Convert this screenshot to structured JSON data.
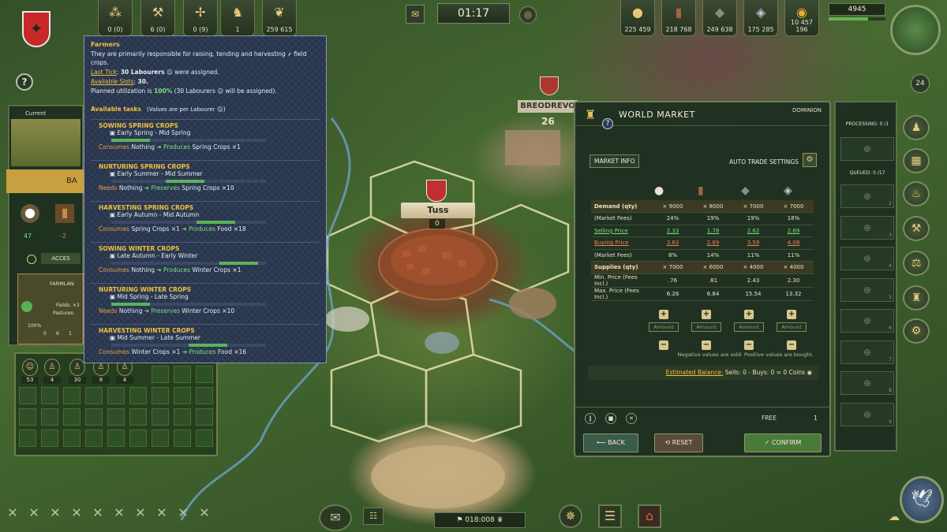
{
  "top_bar": {
    "workers": [
      "0 (0)",
      "6 (0)",
      "0 (9)",
      "1",
      "259 615"
    ],
    "clock": "01:17",
    "resources": [
      "225 459",
      "218 768",
      "249 638",
      "175 285",
      "10 457 196"
    ],
    "gold_value": "4945",
    "notifications": "24"
  },
  "tooltip": {
    "title": "Farmers",
    "desc": "They are primarily responsible for raising, tending and harvesting",
    "desc_tail": "field crops.",
    "last_tick_label": "Last Tick",
    "last_tick_value": "30 Labourers",
    "last_tick_tail": "were assigned.",
    "slots_label": "Available Slots",
    "slots_value": "30.",
    "planned_prefix": "Planned utilization is",
    "planned_value": "100%",
    "planned_tail": "(30 Labourers",
    "planned_tail2": "will be assigned).",
    "available_tasks": "Available tasks",
    "values_note": "(Values are per Labourer",
    "values_note_tail": ")",
    "tasks": [
      {
        "name": "SOWING SPRING CROPS",
        "dates": "Early Spring - Mid Spring",
        "k1": "Consumes",
        "in": "Nothing",
        "k2": "Produces",
        "out": "Spring Crops ×1",
        "progress": 0.25
      },
      {
        "name": "NURTURING SPRING CROPS",
        "dates": "Early Summer - Mid Summer",
        "k1": "Needs",
        "in": "Nothing",
        "k2": "Preserves",
        "out": "Spring Crops ×10",
        "progress": 0.25
      },
      {
        "name": "HARVESTING SPRING CROPS",
        "dates": "Early Autumn - Mid Autumn",
        "k1": "Consumes",
        "in": "Spring Crops ×1",
        "k2": "Produces",
        "out": "Food ×18",
        "progress": 0.25
      },
      {
        "name": "SOWING WINTER CROPS",
        "dates": "Late Autumn - Early Winter",
        "k1": "Consumes",
        "in": "Nothing",
        "k2": "Produces",
        "out": "Winter Crops ×1",
        "progress": 0.25
      },
      {
        "name": "NURTURING WINTER CROPS",
        "dates": "Mid Spring - Late Spring",
        "k1": "Needs",
        "in": "Nothing",
        "k2": "Preserves",
        "out": "Winter Crops ×10",
        "progress": 0.25
      },
      {
        "name": "HARVESTING WINTER CROPS",
        "dates": "Mid Summer - Late Summer",
        "k1": "Consumes",
        "in": "Winter Crops ×1",
        "k2": "Produces",
        "out": "Food ×16",
        "progress": 0.25
      }
    ]
  },
  "market": {
    "title": "WORLD MARKET",
    "dominion": "DOMINION",
    "tab": "MARKET INFO",
    "auto_trade": "AUTO TRADE SETTINGS",
    "rows": [
      {
        "label": "Demand (qty)",
        "v": [
          "× 9000",
          "× 8000",
          "× 7000",
          "× 7000"
        ],
        "hi": true
      },
      {
        "label": "(Market Fees)",
        "v": [
          "24%",
          "19%",
          "19%",
          "18%"
        ]
      },
      {
        "label": "Selling Price",
        "v": [
          "2.33",
          "1.78",
          "2.62",
          "2.69"
        ],
        "kind": "sell"
      },
      {
        "label": "Buying Price",
        "v": [
          "3.63",
          "2.89",
          "3.59",
          "4.08"
        ],
        "kind": "buy"
      },
      {
        "label": "(Market Fees)",
        "v": [
          "8%",
          "14%",
          "11%",
          "11%"
        ]
      },
      {
        "label": "Supplies (qty)",
        "v": [
          "× 7000",
          "× 6000",
          "× 4000",
          "× 4000"
        ],
        "hi": true
      },
      {
        "label": "Min. Price (Fees Incl.)",
        "v": [
          ".76",
          ".81",
          "2.43",
          "2.30"
        ]
      },
      {
        "label": "Max. Price (Fees Incl.)",
        "v": [
          "6.26",
          "6.84",
          "15.54",
          "13.32"
        ]
      }
    ],
    "amount_placeholder": "Amount",
    "note": "Negative values are sold. Positive values are bought.",
    "balance_label": "Estimated Balance:",
    "balance_text": "Sells: 0 - Buys: 0 = 0 Coins",
    "free_label": "FREE",
    "free_value": "1",
    "back": "BACK",
    "reset": "RESET",
    "confirm": "CONFIRM"
  },
  "queue": {
    "processing": "PROCESSING: 0 /1",
    "queued": "QUEUED: 0 /17",
    "slot_numbers": [
      "2",
      "3",
      "4",
      "5",
      "6",
      "7",
      "8",
      "9"
    ]
  },
  "left": {
    "current": "Current",
    "ba_label": "BA",
    "stats": [
      "47",
      "-2"
    ],
    "access_label": "ACCES",
    "farmland_label": "FARMLAN",
    "fields_label": "Fields: ×3",
    "pastures_label": "Pastures: ",
    "pct": "100%",
    "small_vals": [
      "0",
      "6",
      "1"
    ],
    "pawn_values": [
      "53",
      "4",
      "30",
      "8",
      "4"
    ]
  },
  "map": {
    "town": "Tuss",
    "town_count": "0",
    "other_town": "BREODREVO",
    "other_count": "26"
  },
  "bottom": {
    "timer": "018:008"
  }
}
